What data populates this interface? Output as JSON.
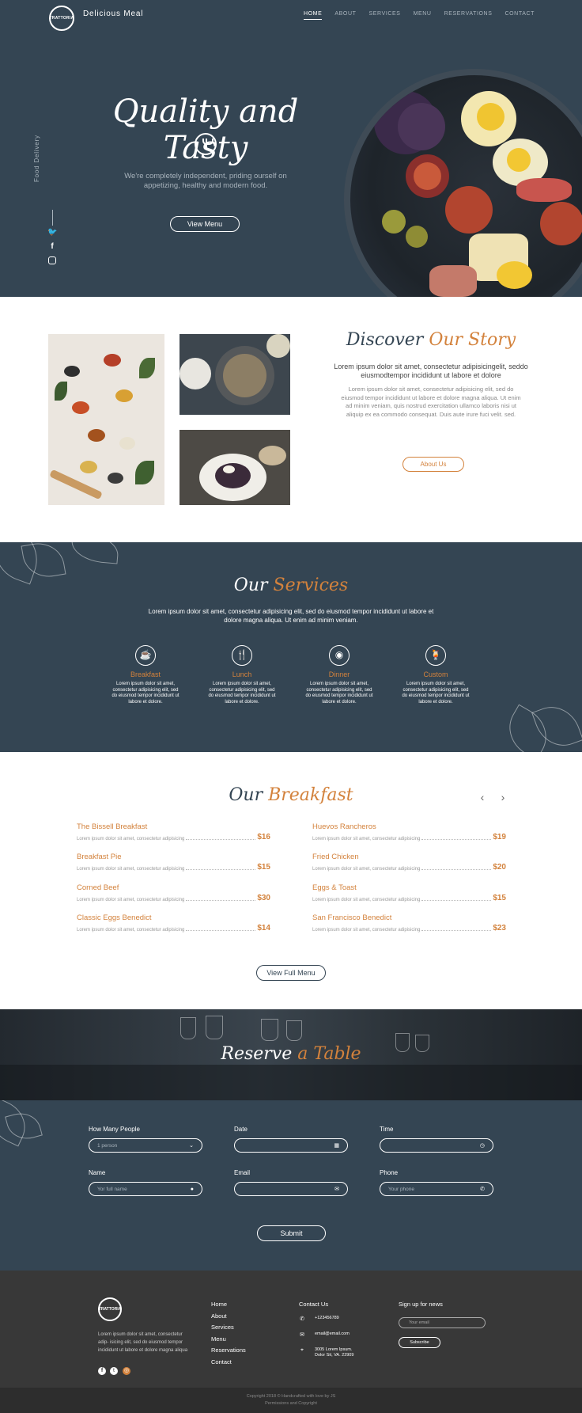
{
  "brand": {
    "logo_text": "TRATTORIA",
    "name": "Delicious Meal"
  },
  "nav": {
    "items": [
      "HOME",
      "ABOUT",
      "SERVICES",
      "MENU",
      "RESERVATIONS",
      "CONTACT"
    ],
    "active": "HOME"
  },
  "hero": {
    "title": "Quality and Tasty",
    "subtitle": "We're completely independent, priding ourself on appetizing, healthy and modern food.",
    "button": "View Menu",
    "side_label": "Food Delivery",
    "social_icons": [
      "twitter-icon",
      "facebook-icon",
      "instagram-icon"
    ]
  },
  "story": {
    "title_a": "Discover",
    "title_b": "Our Story",
    "lead": "Lorem ipsum dolor sit amet, consectetur adipisicingelit, seddo eiusmodtempor incididunt ut labore et dolore",
    "text": "Lorem ipsum dolor sit amet, consectetur adipisicing elit, sed do eiusmod tempor incididunt ut labore et dolore magna aliqua. Ut enim ad minim veniam, quis nostrud exercitation ullamco laboris nisi ut aliquip ex ea commodo consequat. Duis aute irure fuci velit. sed.",
    "button": "About Us"
  },
  "services": {
    "title_a": "Our",
    "title_b": "Services",
    "text": "Lorem ipsum dolor sit amet, consectetur adipisicing elit, sed do eiusmod tempor incididunt ut labore et dolore magna aliqua. Ut enim ad minim veniam.",
    "items": [
      {
        "title": "Breakfast",
        "icon": "coffee-cup-icon",
        "text": "Lorem ipsum dolor sit amet, consectetur adipisicing elit, sed do eiusmod tempor incididunt ut labore et dolore."
      },
      {
        "title": "Lunch",
        "icon": "lunch-icon",
        "text": "Lorem ipsum dolor sit amet, consectetur adipisicing elit, sed do eiusmod tempor incididunt ut labore et dolore."
      },
      {
        "title": "Dinner",
        "icon": "dinner-plate-icon",
        "text": "Lorem ipsum dolor sit amet, consectetur adipisicing elit, sed do eiusmod tempor incididunt ut labore et dolore."
      },
      {
        "title": "Custom",
        "icon": "drink-icon",
        "text": "Lorem ipsum dolor sit amet, consectetur adipisicing elit, sed do eiusmod tempor incididunt ut labore et dolore."
      }
    ]
  },
  "breakfast": {
    "title_a": "Our",
    "title_b": "Breakfast",
    "items": [
      {
        "name": "The Bissell Breakfast",
        "desc": "Lorem ipsum dolor sit amet, consectetur adipisicing",
        "price": "$16"
      },
      {
        "name": "Huevos Rancheros",
        "desc": "Lorem ipsum dolor sit amet, consectetur adipisicing",
        "price": "$19"
      },
      {
        "name": "Breakfast Pie",
        "desc": "Lorem ipsum dolor sit amet, consectetur adipisicing",
        "price": "$15"
      },
      {
        "name": "Fried Chicken",
        "desc": "Lorem ipsum dolor sit amet, consectetur adipisicing",
        "price": "$20"
      },
      {
        "name": "Corned Beef",
        "desc": "Lorem ipsum dolor sit amet, consectetur adipisicing",
        "price": "$30"
      },
      {
        "name": "Eggs & Toast",
        "desc": "Lorem ipsum dolor sit amet, consectetur adipisicing",
        "price": "$15"
      },
      {
        "name": "Classic Eggs Benedict",
        "desc": "Lorem ipsum dolor sit amet, consectetur adipisicing",
        "price": "$14"
      },
      {
        "name": "San Francisco Benedict",
        "desc": "Lorem ipsum dolor sit amet, consectetur adipisicing",
        "price": "$23"
      }
    ],
    "button": "View Full Menu"
  },
  "reserve": {
    "title_a": "Reserve",
    "title_b": "a Table",
    "fields": {
      "people": {
        "label": "How Many People",
        "value": "1 person"
      },
      "date": {
        "label": "Date",
        "value": ""
      },
      "time": {
        "label": "Time",
        "value": ""
      },
      "name": {
        "label": "Name",
        "placeholder": "Yor full name"
      },
      "email": {
        "label": "Email",
        "placeholder": ""
      },
      "phone": {
        "label": "Phone",
        "placeholder": "Your phone"
      }
    },
    "submit": "Submit"
  },
  "footer": {
    "logo_text": "TRATTORIA",
    "about": "Lorem ipsum dolor sit amet, consectetur adip- isicing elit, sed do eiusmod tempor incididunt ut labore et dolore magna aliqua",
    "links": [
      "Home",
      "About",
      "Services",
      "Menu",
      "Reservations",
      "Contact"
    ],
    "contact_title": "Contact Us",
    "phone": "+123456789",
    "email": "email@email.com",
    "address": "3005 Lorem Ipsum. Dolor Sit, VA. 22909",
    "newsletter_title": "Sign up for news",
    "newsletter_placeholder": "Your email",
    "subscribe": "Subscribe",
    "copyright": "Copyright 2018 © Handcrafted with love by JS",
    "permissions": "Permissions and Copyright"
  },
  "colors": {
    "navy": "#344553",
    "accent": "#d3823c",
    "footer": "#383838"
  }
}
